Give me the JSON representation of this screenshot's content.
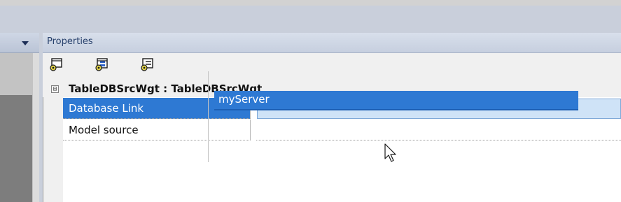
{
  "left_panel": {
    "dropdown_icon": "chevron-down-icon"
  },
  "properties": {
    "title": "Properties",
    "toolbar": [
      {
        "icon": "properties-view-icon"
      },
      {
        "icon": "categorized-view-icon"
      },
      {
        "icon": "alphabetical-view-icon"
      }
    ],
    "category": {
      "label": "TableDBSrcWgt : TableDBSrcWgt",
      "expander_glyph": "⊟"
    },
    "rows": [
      {
        "name": "Database Link",
        "value": "",
        "selected": true
      },
      {
        "name": "Model source",
        "value": ""
      }
    ],
    "dropdown_options": [
      "myServer"
    ]
  },
  "colors": {
    "selection": "#2e79d3",
    "edit_field": "#cfe3f7",
    "panel_header_text": "#27406b"
  }
}
